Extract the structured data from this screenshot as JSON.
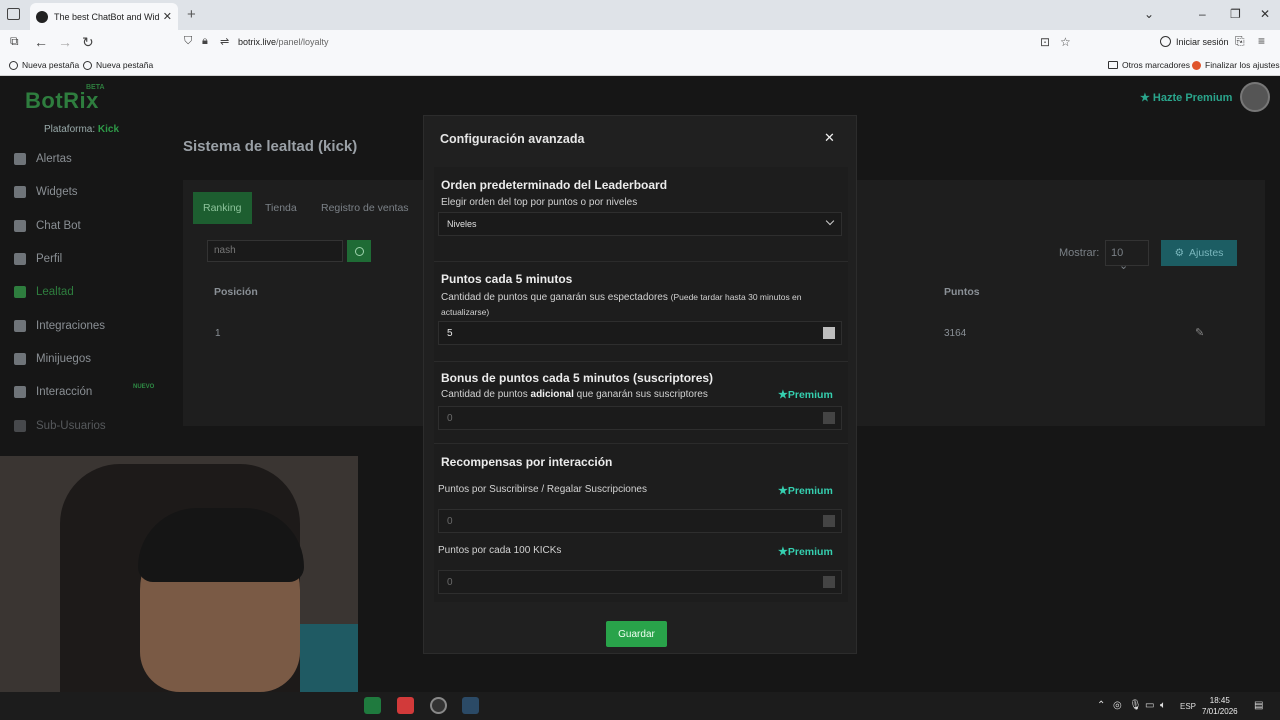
{
  "browser": {
    "tab_title": "The best ChatBot and Widgets f",
    "url_host": "botrix.live",
    "url_path": "/panel/loyalty",
    "signin_label": "Iniciar sesión",
    "bookmarks": [
      "Nueva pestaña",
      "Nueva pestaña"
    ],
    "bookmarks_right": [
      "Otros marcadores",
      "Finalizar los ajustes"
    ]
  },
  "app": {
    "logo": "BotRix",
    "logo_badge": "BETA",
    "platform_label": "Plataforma:",
    "platform_value": "Kick",
    "premium_label": "Hazte Premium",
    "sidebar": [
      {
        "label": "Alertas"
      },
      {
        "label": "Widgets"
      },
      {
        "label": "Chat Bot"
      },
      {
        "label": "Perfil"
      },
      {
        "label": "Lealtad"
      },
      {
        "label": "Integraciones"
      },
      {
        "label": "Minijuegos"
      },
      {
        "label": "Interacción"
      },
      {
        "label": "Sub-Usuarios"
      }
    ],
    "nuevo_badge": "NUEVO"
  },
  "main": {
    "title": "Sistema de lealtad (kick)",
    "tabs": [
      {
        "label": "Ranking"
      },
      {
        "label": "Tienda"
      },
      {
        "label": "Registro de ventas"
      }
    ],
    "search_value": "nash",
    "show_label": "Mostrar:",
    "show_value": "10",
    "settings_label": "Ajustes",
    "columns": [
      "Posición",
      "Puntos"
    ],
    "rows": [
      {
        "position": "1",
        "points": "3164"
      }
    ]
  },
  "modal": {
    "title": "Configuración avanzada",
    "leaderboard": {
      "title": "Orden predeterminado del Leaderboard",
      "desc": "Elegir orden del top por puntos o por niveles",
      "selected": "Niveles"
    },
    "points5": {
      "title": "Puntos cada 5 minutos",
      "desc": "Cantidad de puntos que ganarán sus espectadores",
      "note_1": "(Puede tardar hasta 30 minutos en",
      "note_2": "actualizarse)",
      "value": "5"
    },
    "bonus": {
      "title": "Bonus de puntos cada 5 minutos (suscriptores)",
      "desc_pre": "Cantidad de puntos",
      "desc_bold": "adicional",
      "desc_post": "que ganarán sus suscriptores",
      "premium": "Premium",
      "value": "0"
    },
    "rewards": {
      "title": "Recompensas por interacción",
      "sub_label": "Puntos por Suscribirse / Regalar Suscripciones",
      "sub_premium": "Premium",
      "sub_value": "0",
      "kicks_label": "Puntos por cada 100 KICKs",
      "kicks_premium": "Premium",
      "kicks_value": "0"
    },
    "save_label": "Guardar"
  },
  "taskbar": {
    "lang": "ESP",
    "time": "18:45",
    "date": "7/01/2026"
  }
}
